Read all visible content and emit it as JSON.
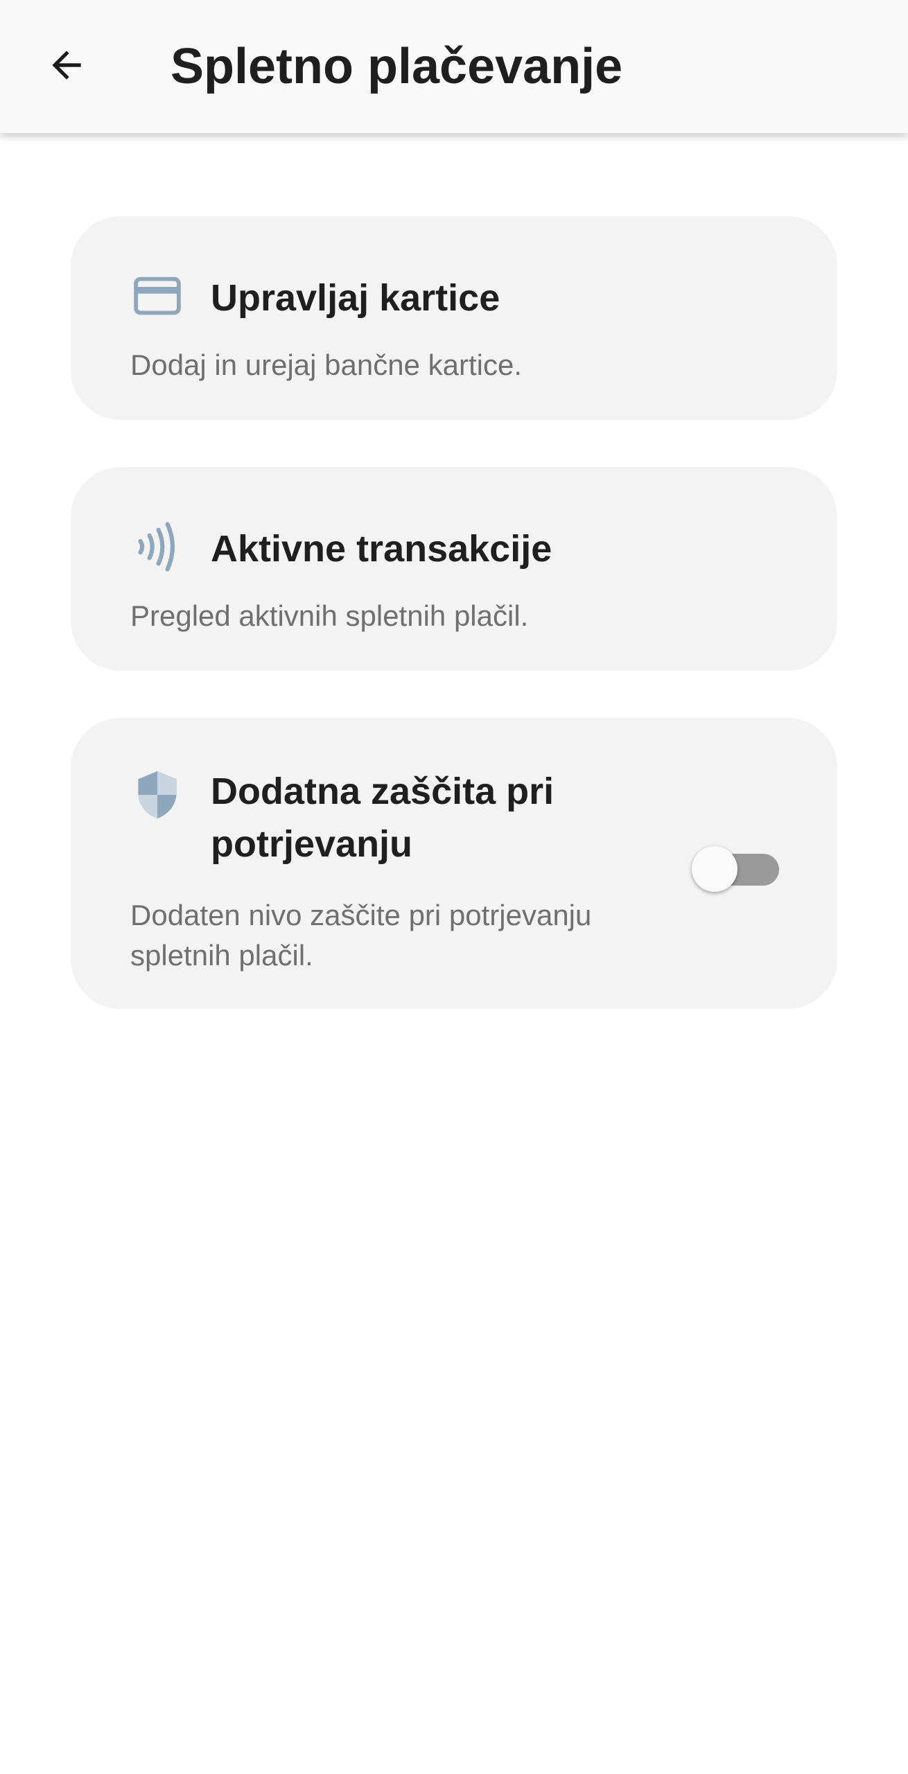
{
  "header": {
    "title": "Spletno plačevanje",
    "back_icon": "arrow-back-icon"
  },
  "colors": {
    "icon_accent": "#8ea7bd",
    "card_background": "#f3f3f3",
    "toggle_track_off": "#9a9a9a"
  },
  "cards": [
    {
      "icon": "credit-card-icon",
      "title": "Upravljaj kartice",
      "subtitle": "Dodaj in urejaj bančne kartice."
    },
    {
      "icon": "contactless-icon",
      "title": "Aktivne transakcije",
      "subtitle": "Pregled aktivnih spletnih plačil."
    },
    {
      "icon": "shield-icon",
      "title": "Dodatna zaščita pri potrjevanju",
      "subtitle": "Dodaten nivo zaščite pri potrjevanju spletnih plačil.",
      "toggle_on": false
    }
  ]
}
